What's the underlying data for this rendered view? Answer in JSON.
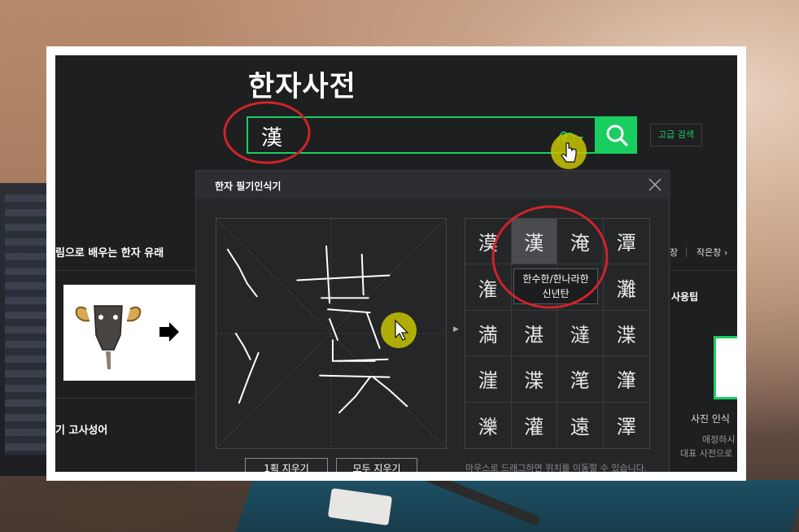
{
  "header": {
    "title": "한자사전",
    "search_value": "漢",
    "advanced_search_label": "고급 검색"
  },
  "background_page": {
    "section1_title": "림으로 배우는 한자 유래",
    "section2_title": "기 고사성어",
    "right_links": [
      "장",
      "작은창 ›"
    ],
    "tips_title": "사용팁",
    "photo_caption": "사진 인식",
    "desc_line1": "애정하시",
    "desc_line2": "대표 사전으로"
  },
  "handwriting_popup": {
    "title": "한자 필기인식기",
    "candidates": [
      "漠",
      "漢",
      "淹",
      "潭",
      "潅",
      "漢",
      "漢",
      "灘",
      "満",
      "湛",
      "澾",
      "渫",
      "漄",
      "渫",
      "滗",
      "潷",
      "濼",
      "灌",
      "遠",
      "澤"
    ],
    "selected_index": 1,
    "tooltip_line1": "한수한/한나라한",
    "tooltip_line2": "신년탄",
    "hint": "마우스로 드래그하면 위치를 이동할 수 있습니다.",
    "erase_one_label": "1획 지우기",
    "erase_all_label": "모두 지우기"
  },
  "colors": {
    "accent": "#19ce60",
    "annotation_red": "#d0232a",
    "cursor_highlight": "#c8c400"
  },
  "icons": {
    "search": "search-icon",
    "handwrite": "handwriting-pen-icon",
    "close": "close-icon",
    "cursor": "hand-cursor-icon"
  }
}
